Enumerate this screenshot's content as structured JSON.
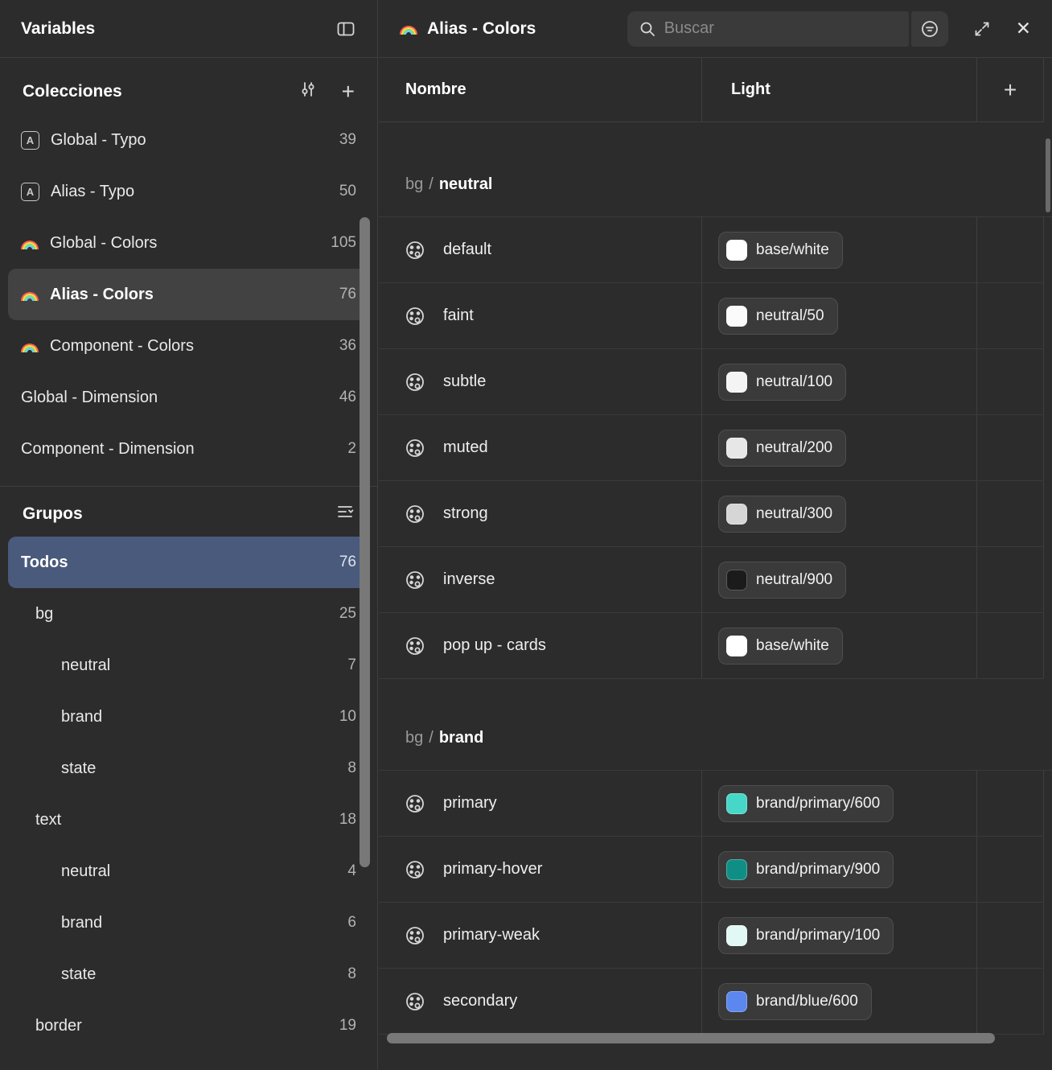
{
  "sidebar": {
    "title": "Variables",
    "collections": {
      "heading": "Colecciones",
      "items": [
        {
          "label": "Global - Typo",
          "count": "39"
        },
        {
          "label": "Alias - Typo",
          "count": "50"
        },
        {
          "label": "Global - Colors",
          "count": "105"
        },
        {
          "label": "Alias - Colors",
          "count": "76"
        },
        {
          "label": "Component - Colors",
          "count": "36"
        },
        {
          "label": "Global - Dimension",
          "count": "46"
        },
        {
          "label": "Component - Dimension",
          "count": "2"
        }
      ]
    },
    "groups": {
      "heading": "Grupos",
      "items": [
        {
          "label": "Todos",
          "count": "76"
        },
        {
          "label": "bg",
          "count": "25"
        },
        {
          "label": "neutral",
          "count": "7"
        },
        {
          "label": "brand",
          "count": "10"
        },
        {
          "label": "state",
          "count": "8"
        },
        {
          "label": "text",
          "count": "18"
        },
        {
          "label": "neutral",
          "count": "4"
        },
        {
          "label": "brand",
          "count": "6"
        },
        {
          "label": "state",
          "count": "8"
        },
        {
          "label": "border",
          "count": "19"
        }
      ]
    }
  },
  "panel": {
    "title": "Alias - Colors",
    "search_placeholder": "Buscar",
    "columns": {
      "name": "Nombre",
      "mode": "Light",
      "add": "+"
    },
    "sections": [
      {
        "prefix": "bg",
        "sep": "/",
        "name": "neutral",
        "rows": [
          {
            "name": "default",
            "value": "base/white",
            "swatch": "#ffffff"
          },
          {
            "name": "faint",
            "value": "neutral/50",
            "swatch": "#fbfbfb"
          },
          {
            "name": "subtle",
            "value": "neutral/100",
            "swatch": "#f4f4f4"
          },
          {
            "name": "muted",
            "value": "neutral/200",
            "swatch": "#e7e7e7"
          },
          {
            "name": "strong",
            "value": "neutral/300",
            "swatch": "#d6d6d6"
          },
          {
            "name": "inverse",
            "value": "neutral/900",
            "swatch": "#1b1b1b"
          },
          {
            "name": "pop up - cards",
            "value": "base/white",
            "swatch": "#ffffff"
          }
        ]
      },
      {
        "prefix": "bg",
        "sep": "/",
        "name": "brand",
        "rows": [
          {
            "name": "primary",
            "value": "brand/primary/600",
            "swatch": "#47d7c8"
          },
          {
            "name": "primary-hover",
            "value": "brand/primary/900",
            "swatch": "#0f8e86"
          },
          {
            "name": "primary-weak",
            "value": "brand/primary/100",
            "swatch": "#e2f8f5"
          },
          {
            "name": "secondary",
            "value": "brand/blue/600",
            "swatch": "#5b87ee"
          }
        ]
      }
    ]
  }
}
